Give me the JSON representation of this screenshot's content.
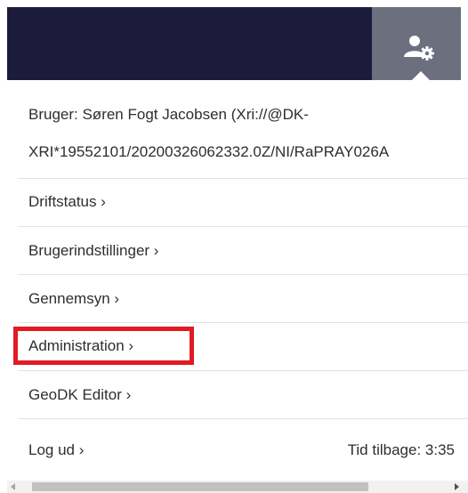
{
  "header": {
    "user_settings_icon": "user-gear-icon"
  },
  "menu": {
    "user_line1": "Bruger: Søren Fogt Jacobsen (Xri://@DK-",
    "user_line2": "XRI*19552101/20200326062332.0Z/NI/RaPRAY026A",
    "items": [
      {
        "label": "Driftstatus ›"
      },
      {
        "label": "Brugerindstillinger ›"
      },
      {
        "label": "Gennemsyn ›"
      },
      {
        "label": "Administration ›"
      },
      {
        "label": "GeoDK Editor ›"
      },
      {
        "label": "Log ud ›"
      }
    ],
    "timer": "Tid tilbage: 3:35"
  },
  "colors": {
    "header_bg": "#1c1b3c",
    "user_button_bg": "#6b6f7e",
    "highlight": "#e01b24"
  }
}
